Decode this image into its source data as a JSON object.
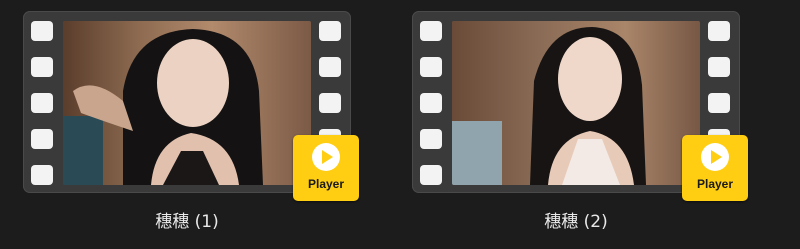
{
  "items": [
    {
      "title": "穗穗 (1)",
      "badge_icon": "play-icon",
      "badge_label": "Player"
    },
    {
      "title": "穗穗 (2)",
      "badge_icon": "play-icon",
      "badge_label": "Player"
    }
  ],
  "colors": {
    "background": "#1c1c1c",
    "film_strip": "#3a3a3a",
    "film_hole": "#f3f3f3",
    "badge": "#ffce13",
    "caption_text": "#e8e8e8"
  }
}
